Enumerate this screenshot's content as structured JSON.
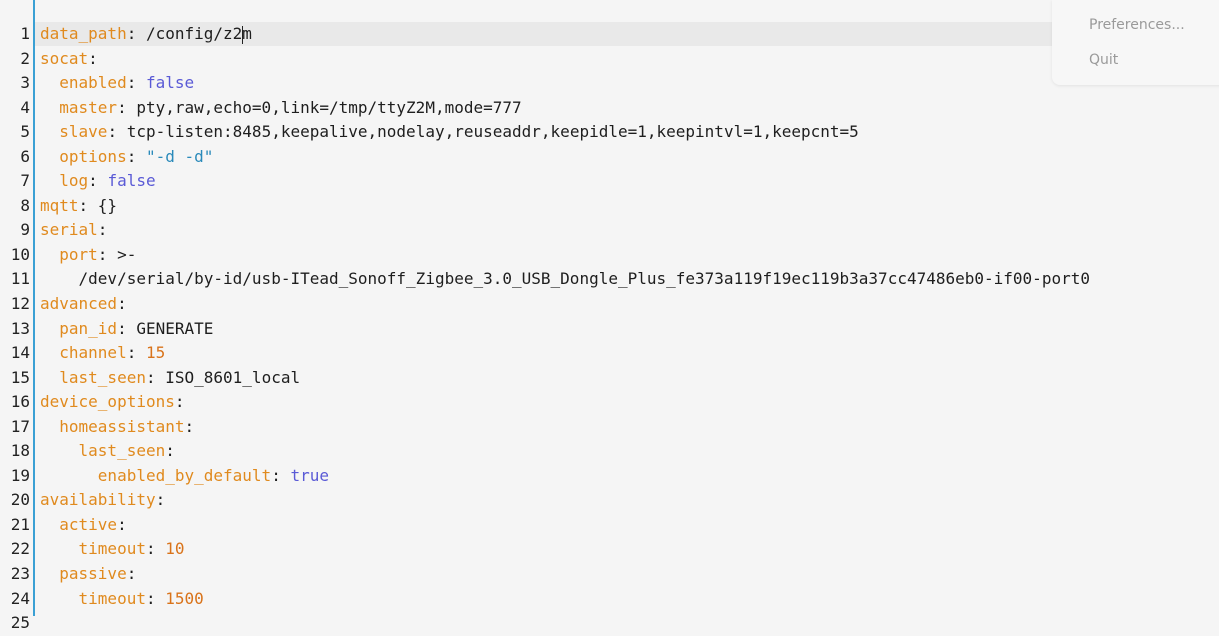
{
  "editor": {
    "lines": [
      {
        "n": "1",
        "tokens": [
          {
            "t": "data_path",
            "c": "key"
          },
          {
            "t": ": ",
            "c": "punct"
          },
          {
            "t": "/config/z2",
            "c": "val"
          },
          {
            "t": "|CURSOR|",
            "c": "cursor"
          },
          {
            "t": "m",
            "c": "val"
          }
        ]
      },
      {
        "n": "2",
        "tokens": [
          {
            "t": "socat",
            "c": "key"
          },
          {
            "t": ":",
            "c": "punct"
          }
        ]
      },
      {
        "n": "3",
        "tokens": [
          {
            "t": "  enabled",
            "c": "key"
          },
          {
            "t": ": ",
            "c": "punct"
          },
          {
            "t": "false",
            "c": "bool"
          }
        ]
      },
      {
        "n": "4",
        "tokens": [
          {
            "t": "  master",
            "c": "key"
          },
          {
            "t": ": ",
            "c": "punct"
          },
          {
            "t": "pty,raw,echo=0,link=/tmp/ttyZ2M,mode=777",
            "c": "val"
          }
        ]
      },
      {
        "n": "5",
        "tokens": [
          {
            "t": "  slave",
            "c": "key"
          },
          {
            "t": ": ",
            "c": "punct"
          },
          {
            "t": "tcp-listen:8485,keepalive,nodelay,reuseaddr,keepidle=1,keepintvl=1,keepcnt=5",
            "c": "val"
          }
        ]
      },
      {
        "n": "6",
        "tokens": [
          {
            "t": "  options",
            "c": "key"
          },
          {
            "t": ": ",
            "c": "punct"
          },
          {
            "t": "\"-d -d\"",
            "c": "str"
          }
        ]
      },
      {
        "n": "7",
        "tokens": [
          {
            "t": "  log",
            "c": "key"
          },
          {
            "t": ": ",
            "c": "punct"
          },
          {
            "t": "false",
            "c": "bool"
          }
        ]
      },
      {
        "n": "8",
        "tokens": [
          {
            "t": "mqtt",
            "c": "key"
          },
          {
            "t": ": ",
            "c": "punct"
          },
          {
            "t": "{}",
            "c": "val"
          }
        ]
      },
      {
        "n": "9",
        "tokens": [
          {
            "t": "serial",
            "c": "key"
          },
          {
            "t": ":",
            "c": "punct"
          }
        ]
      },
      {
        "n": "10",
        "tokens": [
          {
            "t": "  port",
            "c": "key"
          },
          {
            "t": ": ",
            "c": "punct"
          },
          {
            "t": ">-",
            "c": "val"
          }
        ]
      },
      {
        "n": "11",
        "tokens": [
          {
            "t": "    /dev/serial/by-id/usb-ITead_Sonoff_Zigbee_3.0_USB_Dongle_Plus_fe373a119f19ec119b3a37cc47486eb0-if00-port0",
            "c": "val"
          }
        ]
      },
      {
        "n": "12",
        "tokens": [
          {
            "t": "advanced",
            "c": "key"
          },
          {
            "t": ":",
            "c": "punct"
          }
        ]
      },
      {
        "n": "13",
        "tokens": [
          {
            "t": "  pan_id",
            "c": "key"
          },
          {
            "t": ": ",
            "c": "punct"
          },
          {
            "t": "GENERATE",
            "c": "val"
          }
        ]
      },
      {
        "n": "14",
        "tokens": [
          {
            "t": "  channel",
            "c": "key"
          },
          {
            "t": ": ",
            "c": "punct"
          },
          {
            "t": "15",
            "c": "num"
          }
        ]
      },
      {
        "n": "15",
        "tokens": [
          {
            "t": "  last_seen",
            "c": "key"
          },
          {
            "t": ": ",
            "c": "punct"
          },
          {
            "t": "ISO_8601_local",
            "c": "val"
          }
        ]
      },
      {
        "n": "16",
        "tokens": [
          {
            "t": "device_options",
            "c": "key"
          },
          {
            "t": ":",
            "c": "punct"
          }
        ]
      },
      {
        "n": "17",
        "tokens": [
          {
            "t": "  homeassistant",
            "c": "key"
          },
          {
            "t": ":",
            "c": "punct"
          }
        ]
      },
      {
        "n": "18",
        "tokens": [
          {
            "t": "    last_seen",
            "c": "key"
          },
          {
            "t": ":",
            "c": "punct"
          }
        ]
      },
      {
        "n": "19",
        "tokens": [
          {
            "t": "      enabled_by_default",
            "c": "key"
          },
          {
            "t": ": ",
            "c": "punct"
          },
          {
            "t": "true",
            "c": "bool"
          }
        ]
      },
      {
        "n": "20",
        "tokens": [
          {
            "t": "availability",
            "c": "key"
          },
          {
            "t": ":",
            "c": "punct"
          }
        ]
      },
      {
        "n": "21",
        "tokens": [
          {
            "t": "  active",
            "c": "key"
          },
          {
            "t": ":",
            "c": "punct"
          }
        ]
      },
      {
        "n": "22",
        "tokens": [
          {
            "t": "    timeout",
            "c": "key"
          },
          {
            "t": ": ",
            "c": "punct"
          },
          {
            "t": "10",
            "c": "num"
          }
        ]
      },
      {
        "n": "23",
        "tokens": [
          {
            "t": "  passive",
            "c": "key"
          },
          {
            "t": ":",
            "c": "punct"
          }
        ]
      },
      {
        "n": "24",
        "tokens": [
          {
            "t": "    timeout",
            "c": "key"
          },
          {
            "t": ": ",
            "c": "punct"
          },
          {
            "t": "1500",
            "c": "num"
          }
        ]
      },
      {
        "n": "25",
        "tokens": []
      }
    ]
  },
  "menu": {
    "preferences_label": "Preferences...",
    "quit_label": "Quit"
  },
  "colors": {
    "key": "#e08a1e",
    "bool": "#5a5ad6",
    "number": "#d9731a",
    "string": "#2a8aba",
    "gutter_border": "#3aa0d4"
  }
}
